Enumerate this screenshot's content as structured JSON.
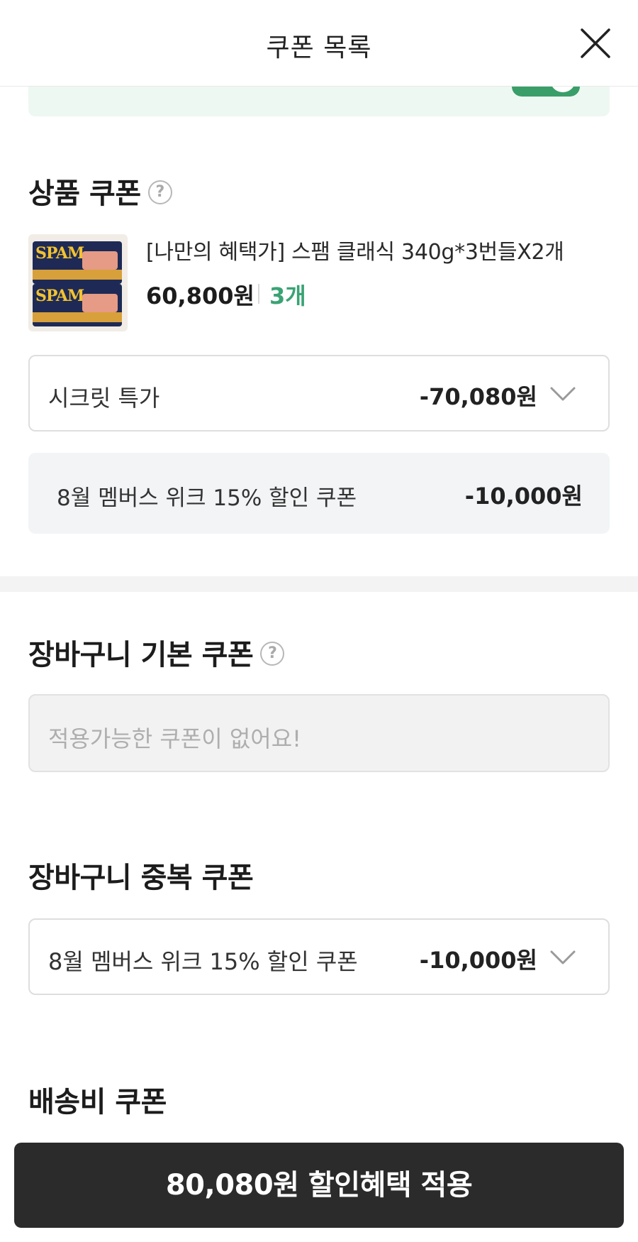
{
  "header": {
    "title": "쿠폰 목록"
  },
  "product_coupon": {
    "section_title": "상품 쿠폰",
    "product": {
      "name": "[나만의 혜택가] 스팸 클래식 340g*3번들X2개",
      "price": "60,800원",
      "quantity": "3개",
      "image_text": "SPAM"
    },
    "select": {
      "label": "시크릿 특가",
      "amount": "-70,080원"
    },
    "info": {
      "label": "8월 멤버스 위크 15% 할인 쿠폰",
      "amount": "-10,000원"
    }
  },
  "cart_basic_coupon": {
    "section_title": "장바구니 기본 쿠폰",
    "empty_message": "적용가능한 쿠폰이 없어요!"
  },
  "cart_dup_coupon": {
    "section_title": "장바구니 중복 쿠폰",
    "select": {
      "label": "8월 멤버스 위크 15% 할인 쿠폰",
      "amount": "-10,000원"
    }
  },
  "shipping_coupon": {
    "section_title": "배송비 쿠폰"
  },
  "apply_button": {
    "label": "80,080원 할인혜택 적용"
  },
  "colors": {
    "accent_green": "#3aa374",
    "toggle_green": "#3a9e68",
    "button_dark": "#2b2b2b"
  }
}
